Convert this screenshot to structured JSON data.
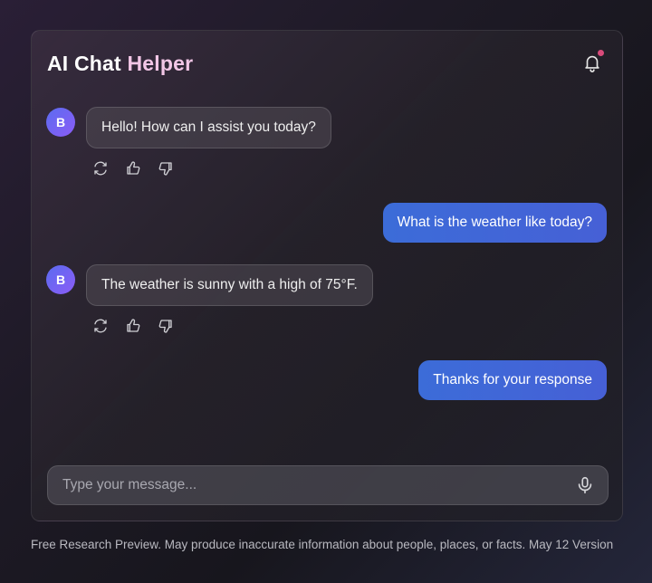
{
  "header": {
    "title_part1": "AI Chat",
    "title_part2": "Helper",
    "notification_icon": "bell-icon"
  },
  "messages": [
    {
      "role": "assistant",
      "avatar": "B",
      "text": "Hello! How can I assist you today?"
    },
    {
      "role": "user",
      "text": "What is the weather like today?"
    },
    {
      "role": "assistant",
      "avatar": "B",
      "text": "The weather is sunny with a high of 75°F."
    },
    {
      "role": "user",
      "text": "Thanks for your response"
    }
  ],
  "message_actions": [
    "regenerate-icon",
    "thumbs-up-icon",
    "thumbs-down-icon"
  ],
  "composer": {
    "placeholder": "Type your message...",
    "value": "",
    "mic_icon": "microphone-icon"
  },
  "footer": {
    "disclaimer": "Free Research Preview. May produce inaccurate information about people, places, or facts. May 12 Version"
  },
  "colors": {
    "user_bubble": "#3c6cd8",
    "avatar": "#6b64f3",
    "accent_title": "#f2c6e6",
    "notification_dot": "#d94a7a"
  }
}
